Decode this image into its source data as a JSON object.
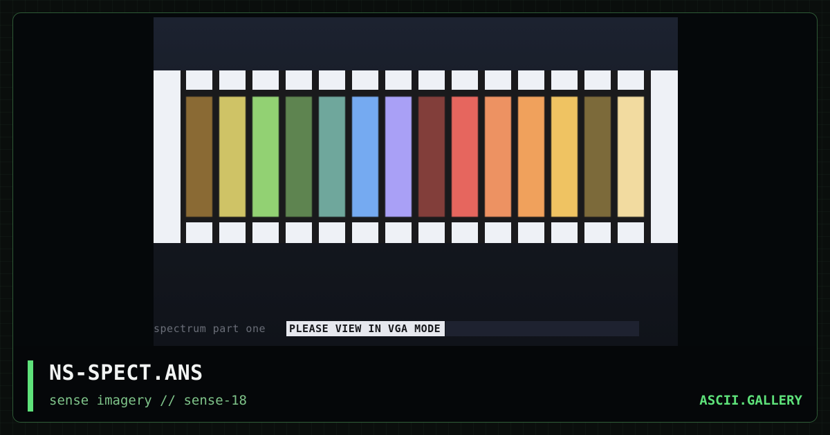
{
  "artwork": {
    "status_left": "spectrum part one",
    "status_mode": "PLEASE VIEW IN VGA MODE",
    "swatches": [
      {
        "color": "#8a6a34"
      },
      {
        "color": "#cfc366"
      },
      {
        "color": "#92d173"
      },
      {
        "color": "#5e8450"
      },
      {
        "color": "#6fa79c"
      },
      {
        "color": "#75aaf1"
      },
      {
        "color": "#a9a0f6"
      },
      {
        "color": "#823e3a"
      },
      {
        "color": "#e6665e"
      },
      {
        "color": "#ed9262"
      },
      {
        "color": "#f0a15c"
      },
      {
        "color": "#efc362"
      },
      {
        "color": "#7c6a3a"
      },
      {
        "color": "#f2dba0"
      }
    ]
  },
  "footer": {
    "title": "NS-SPECT.ANS",
    "subtitle": "sense imagery // sense-18",
    "brand": "ASCII.GALLERY"
  },
  "colors": {
    "accent": "#5ee27a",
    "frame_border": "#2e5a36"
  }
}
